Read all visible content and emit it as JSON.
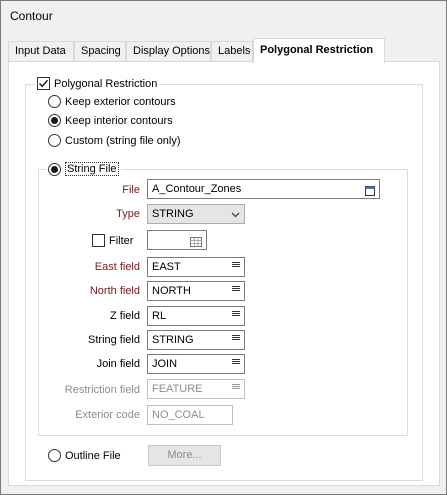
{
  "window": {
    "title": "Contour"
  },
  "tabs": [
    {
      "label": "Input Data",
      "active": false
    },
    {
      "label": "Spacing",
      "active": false
    },
    {
      "label": "Display Options",
      "active": false
    },
    {
      "label": "Labels",
      "active": false
    },
    {
      "label": "Polygonal Restriction",
      "active": true
    }
  ],
  "polygonal": {
    "label": "Polygonal Restriction",
    "checked": true,
    "options": [
      {
        "label": "Keep exterior contours",
        "selected": false
      },
      {
        "label": "Keep interior contours",
        "selected": true
      },
      {
        "label": "Custom (string file only)",
        "selected": false
      }
    ]
  },
  "string_file": {
    "label": "String File",
    "selected": true,
    "file_label": "File",
    "file_value": "A_Contour_Zones",
    "type_label": "Type",
    "type_value": "STRING",
    "filter_label": "Filter",
    "filter_checked": false,
    "filter_value": "",
    "east_label": "East field",
    "east_value": "EAST",
    "north_label": "North field",
    "north_value": "NORTH",
    "z_label": "Z field",
    "z_value": "RL",
    "string_label": "String field",
    "string_value": "STRING",
    "join_label": "Join field",
    "join_value": "JOIN",
    "restriction_label": "Restriction field",
    "restriction_value": "FEATURE",
    "exterior_label": "Exterior code",
    "exterior_value": "NO_COAL"
  },
  "outline_file": {
    "label": "Outline File",
    "selected": false,
    "more_label": "More..."
  },
  "colors": {
    "required_label": "#7a1a1a",
    "disabled_text": "#8c8c8c"
  }
}
